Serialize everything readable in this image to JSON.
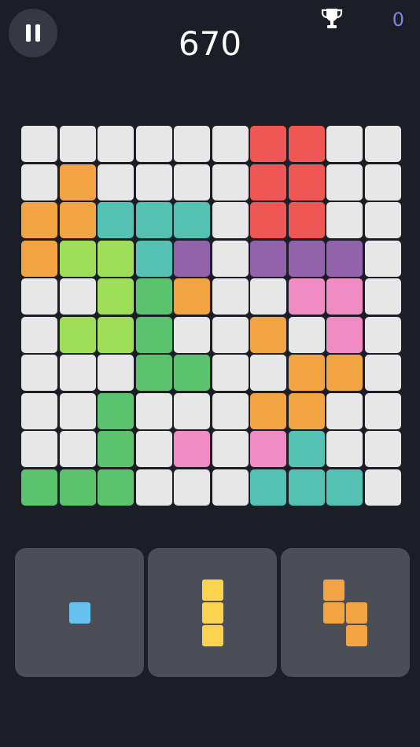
{
  "score": "670",
  "best_score": "0",
  "colors": {
    "empty": "#e7e7e7",
    "red": "#ef5754",
    "orange": "#f2a442",
    "teal": "#54c1b2",
    "lime": "#9fde58",
    "green": "#5bc26d",
    "purple": "#9262aa",
    "pink": "#f08bc4",
    "blue": "#68c1ee",
    "yellow": "#fcd34f"
  },
  "icons": {
    "pause": "pause-icon",
    "trophy": "trophy-icon"
  },
  "board": [
    [
      ".",
      ".",
      ".",
      ".",
      ".",
      ".",
      "r",
      "r",
      ".",
      "."
    ],
    [
      ".",
      "o",
      ".",
      ".",
      ".",
      ".",
      "r",
      "r",
      ".",
      "."
    ],
    [
      "o",
      "o",
      "t",
      "t",
      "t",
      ".",
      "r",
      "r",
      ".",
      "."
    ],
    [
      "o",
      "l",
      "l",
      "t",
      "p",
      ".",
      "p",
      "p",
      "p",
      "."
    ],
    [
      ".",
      ".",
      "l",
      "g",
      "o",
      ".",
      ".",
      "k",
      "k",
      "."
    ],
    [
      ".",
      "l",
      "l",
      "g",
      ".",
      ".",
      "o",
      ".",
      "k",
      "."
    ],
    [
      ".",
      ".",
      ".",
      "g",
      "g",
      ".",
      ".",
      "o",
      "o",
      "."
    ],
    [
      ".",
      ".",
      "g",
      ".",
      ".",
      ".",
      "o",
      "o",
      ".",
      "."
    ],
    [
      ".",
      ".",
      "g",
      ".",
      "k",
      ".",
      "k",
      "t",
      ".",
      "."
    ],
    [
      "g",
      "g",
      "g",
      ".",
      ".",
      ".",
      "t",
      "t",
      "t",
      "."
    ]
  ],
  "pieces": [
    {
      "color": "blue",
      "cells": [
        [
          0,
          0
        ]
      ]
    },
    {
      "color": "yellow",
      "cells": [
        [
          0,
          0
        ],
        [
          1,
          0
        ],
        [
          2,
          0
        ]
      ]
    },
    {
      "color": "orange",
      "cells": [
        [
          0,
          0
        ],
        [
          1,
          0
        ],
        [
          1,
          1
        ],
        [
          2,
          1
        ]
      ]
    }
  ]
}
